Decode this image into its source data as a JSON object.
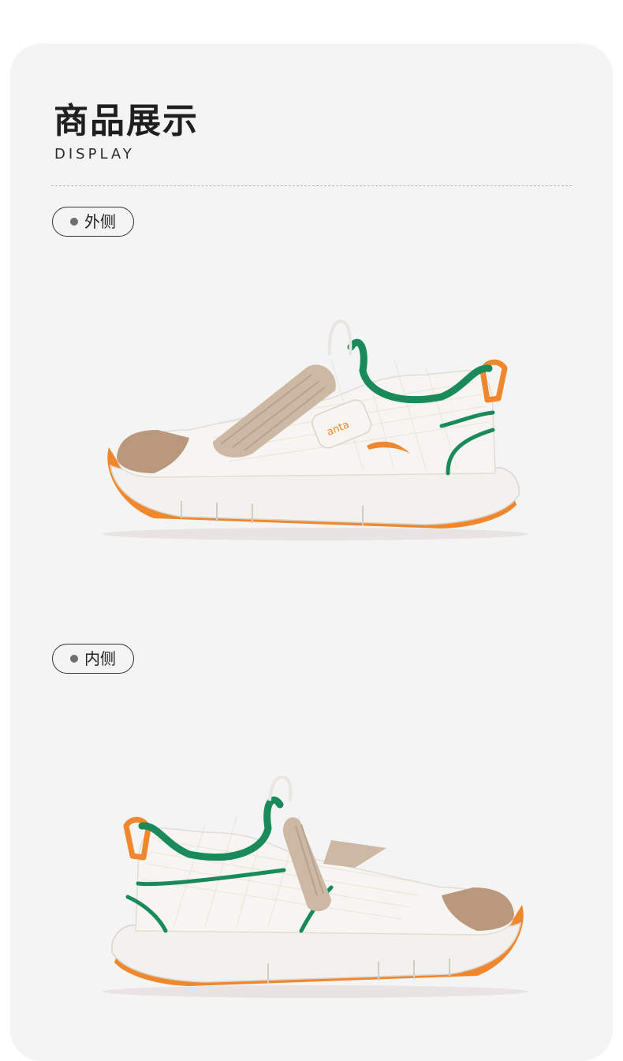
{
  "header": {
    "title": "商品展示",
    "subtitle": "DISPLAY"
  },
  "views": [
    {
      "label": "外侧",
      "image": "shoe-outer-side-photo"
    },
    {
      "label": "内侧",
      "image": "shoe-inner-side-photo"
    }
  ],
  "brand": {
    "logo_text": "anta"
  },
  "colors": {
    "panel_bg": "#f4f4f4",
    "title": "#1f1f1f",
    "shoe_upper": "#f7f5f1",
    "shoe_trim_green": "#1a8a5a",
    "shoe_accent_orange": "#f0872c",
    "shoe_strap_tan": "#cdb8a4",
    "shoe_toe_tan": "#b9987c"
  }
}
